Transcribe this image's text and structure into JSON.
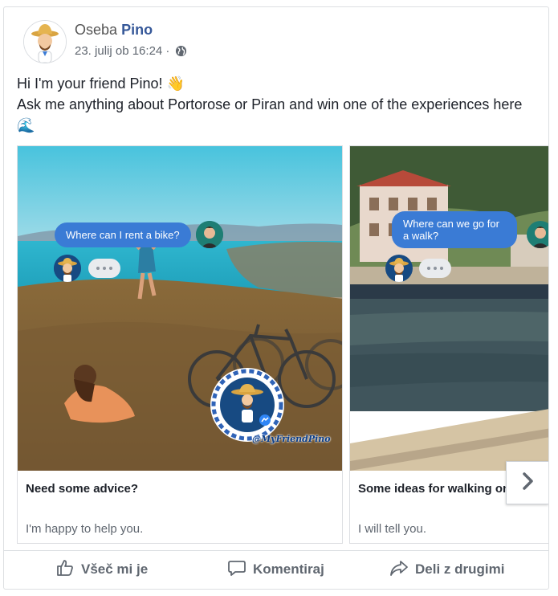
{
  "post": {
    "author_first": "Oseba",
    "author_last": "Pino",
    "timestamp": "23. julij ob 16:24 ·",
    "privacy_icon": "globe-icon",
    "text_line1": "Hi I'm your friend Pino! 👋",
    "text_line2": "Ask me anything about Portorose or Piran and win one of the experiences here 🌊"
  },
  "cards": [
    {
      "bubble": "Where can I rent a bike?",
      "title": "Need some advice?",
      "description": "I'm happy to help you.",
      "signature": "@MyFriendPino"
    },
    {
      "bubble": "Where can we go for a walk?",
      "title": "Some ideas for walking on the",
      "description": "I will tell you."
    }
  ],
  "actions": {
    "like": "Všeč mi je",
    "comment": "Komentiraj",
    "share": "Deli z drugimi"
  },
  "colors": {
    "link": "#365899",
    "chat_bubble": "#3a7bd5",
    "muted_text": "#606770"
  }
}
